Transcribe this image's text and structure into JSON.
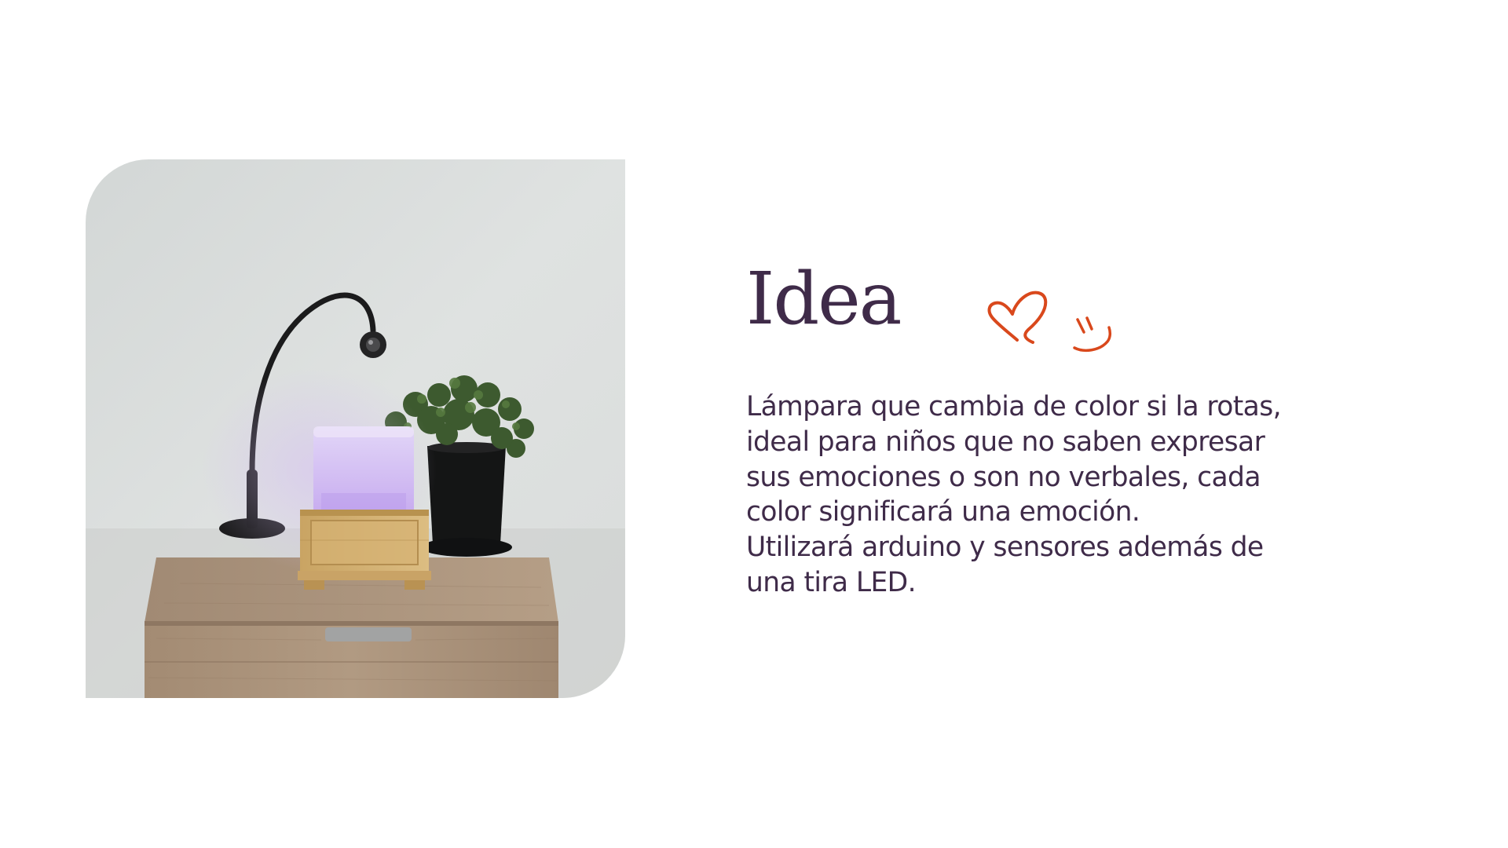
{
  "slide": {
    "title": "Idea",
    "description_lines": [
      "Lámpara que cambia de color si la rotas,",
      "ideal para niños que no saben expresar",
      "sus emociones o son no verbales, cada",
      "color significará una emoción.",
      "Utilizará arduino y sensores además de",
      "una tira LED."
    ]
  },
  "photo": {
    "subject": "cube lamp glowing lavender on a wooden nightstand next to a desk lamp and a potted plant"
  },
  "doodles": [
    "heart-icon",
    "smile-icon"
  ],
  "colors": {
    "text": "#3f2b49",
    "accent": "#d9481c",
    "background": "#ffffff",
    "lamp_glow": "#d8c6f4"
  }
}
